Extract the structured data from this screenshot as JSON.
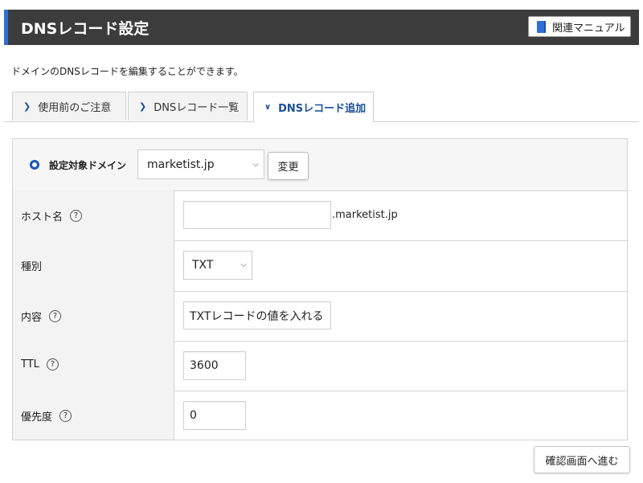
{
  "header": {
    "title": "DNSレコード設定",
    "manual_label": "関連マニュアル"
  },
  "description": "ドメインのDNSレコードを編集することができます。",
  "tabs": [
    {
      "label": "使用前のご注意",
      "active": false
    },
    {
      "label": "DNSレコード一覧",
      "active": false
    },
    {
      "label": "DNSレコード追加",
      "active": true
    }
  ],
  "domain": {
    "label": "設定対象ドメイン",
    "selected": "marketist.jp",
    "change_label": "変更"
  },
  "fields": {
    "host": {
      "label": "ホスト名",
      "value": "",
      "suffix": ".marketist.jp"
    },
    "type": {
      "label": "種別",
      "selected": "TXT"
    },
    "content": {
      "label": "内容",
      "value": "TXTレコードの値を入れる"
    },
    "ttl": {
      "label": "TTL",
      "value": "3600"
    },
    "priority": {
      "label": "優先度",
      "value": "0"
    }
  },
  "help_glyph": "?",
  "confirm_label": "確認画面へ進む",
  "colors": {
    "accent": "#1a56b6",
    "header_bg": "#3c3c3c",
    "header_bar": "#2f6fd6"
  }
}
